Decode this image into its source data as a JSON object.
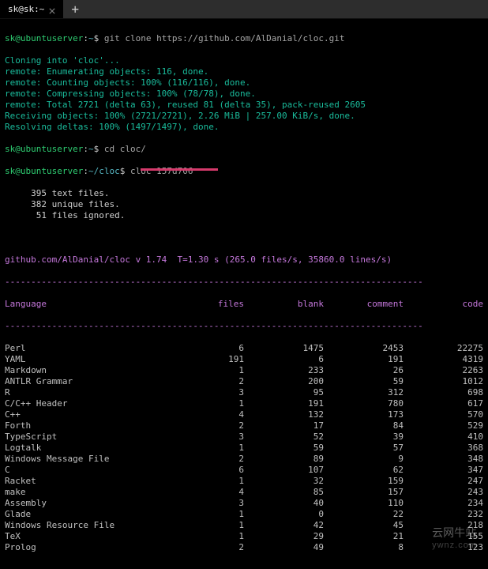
{
  "tabs": [
    {
      "label": "sk@sk:~"
    }
  ],
  "session": {
    "prompt1_user": "sk@ubuntuserver",
    "prompt1_path": "~",
    "cmd1": "git clone https://github.com/AlDanial/cloc.git",
    "clone_lines": [
      "Cloning into 'cloc'...",
      "remote: Enumerating objects: 116, done.",
      "remote: Counting objects: 100% (116/116), done.",
      "remote: Compressing objects: 100% (78/78), done.",
      "remote: Total 2721 (delta 63), reused 81 (delta 35), pack-reused 2605",
      "Receiving objects: 100% (2721/2721), 2.26 MiB | 257.00 KiB/s, done.",
      "Resolving deltas: 100% (1497/1497), done."
    ],
    "prompt2_user": "sk@ubuntuserver",
    "prompt2_path": "~",
    "cmd2": "cd cloc/",
    "prompt3_user": "sk@ubuntuserver",
    "prompt3_path": "~/cloc",
    "cmd3": "cloc 157d706",
    "pre_summary": [
      "     395 text files.",
      "     382 unique files.",
      "      51 files ignored."
    ],
    "meta": "github.com/AlDanial/cloc v 1.74  T=1.30 s (265.0 files/s, 35860.0 lines/s)"
  },
  "cloc_table": {
    "divider": "--------------------------------------------------------------------------------",
    "headers": [
      "Language",
      "files",
      "blank",
      "comment",
      "code"
    ],
    "rows": [
      [
        "Perl",
        "6",
        "1475",
        "2453",
        "22275"
      ],
      [
        "YAML",
        "191",
        "6",
        "191",
        "4319"
      ],
      [
        "Markdown",
        "1",
        "233",
        "26",
        "2263"
      ],
      [
        "ANTLR Grammar",
        "2",
        "200",
        "59",
        "1012"
      ],
      [
        "R",
        "3",
        "95",
        "312",
        "698"
      ],
      [
        "C/C++ Header",
        "1",
        "191",
        "780",
        "617"
      ],
      [
        "C++",
        "4",
        "132",
        "173",
        "570"
      ],
      [
        "Forth",
        "2",
        "17",
        "84",
        "529"
      ],
      [
        "TypeScript",
        "3",
        "52",
        "39",
        "410"
      ],
      [
        "Logtalk",
        "1",
        "59",
        "57",
        "368"
      ],
      [
        "Windows Message File",
        "2",
        "89",
        "9",
        "348"
      ],
      [
        "C",
        "6",
        "107",
        "62",
        "347"
      ],
      [
        "Racket",
        "1",
        "32",
        "159",
        "247"
      ],
      [
        "make",
        "4",
        "85",
        "157",
        "243"
      ],
      [
        "Assembly",
        "3",
        "40",
        "110",
        "234"
      ],
      [
        "Glade",
        "1",
        "0",
        "22",
        "232"
      ],
      [
        "Windows Resource File",
        "1",
        "42",
        "45",
        "218"
      ],
      [
        "TeX",
        "1",
        "29",
        "21",
        "155"
      ],
      [
        "Prolog",
        "2",
        "49",
        "8",
        "123"
      ]
    ]
  },
  "watermark": {
    "line1": "云网牛站",
    "line2": "ywnz.com"
  }
}
